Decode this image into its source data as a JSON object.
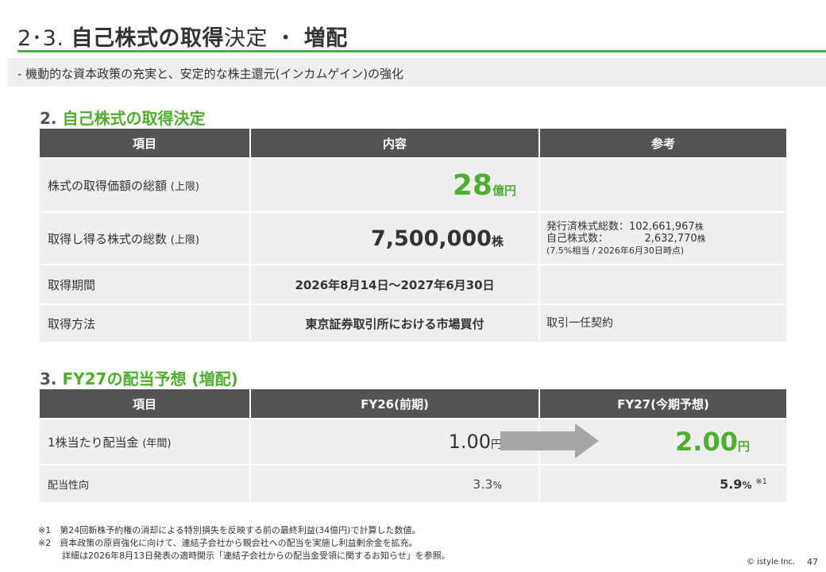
{
  "title": {
    "main_prefix": "2･3. ",
    "bold1": "自己株式の取得",
    "regular": "決定 ・ ",
    "bold2": "増配"
  },
  "subtitle": "- 機動的な資本政策の充実と、安定的な株主還元(インカムゲイン)の強化",
  "section2": {
    "num": "2.",
    "heading": "自己株式の取得決定",
    "headers": [
      "項目",
      "内容",
      "参考"
    ],
    "rows": {
      "amount": {
        "label": "株式の取得価額の総額",
        "label_small": "(上限)",
        "value": "28",
        "unit": "億円",
        "ref": ""
      },
      "shares": {
        "label": "取得し得る株式の総数",
        "label_small": "(上限)",
        "value": "7,500,000",
        "unit": "株",
        "ref_line1_a": "発行済株式総数：102,661,967",
        "ref_line1_b": "株",
        "ref_line2_a": "自己株式数：           2,632,770",
        "ref_line2_b": "株",
        "ref_line3": "(7.5%相当 / 2026年6月30日時点)"
      },
      "period": {
        "label": "取得期間",
        "value": "2026年8月14日～2027年6月30日",
        "ref": ""
      },
      "method": {
        "label": "取得方法",
        "value": "東京証券取引所における市場買付",
        "ref": "取引一任契約"
      }
    }
  },
  "section3": {
    "num": "3.",
    "heading": "FY27の配当予想 (増配)",
    "headers": [
      "項目",
      "FY26(前期)",
      "FY27(今期予想)"
    ],
    "dps": {
      "label": "1株当たり配当金",
      "label_small": "(年間)",
      "fy26_value": "1.00",
      "fy26_unit": "円",
      "fy27_value": "2.00",
      "fy27_unit": "円"
    },
    "payout": {
      "label": "配当性向",
      "fy26_value": "3.3",
      "fy26_unit": "%",
      "fy27_value": "5.9",
      "fy27_unit": "%",
      "fy27_note": "※1"
    }
  },
  "footnotes": {
    "n1_mark": "※1",
    "n1": "第24回新株予約権の消却による特別損失を反映する前の最終利益(34億円)で計算した数値。",
    "n2_mark": "※2",
    "n2_line1": "資本政策の原資強化に向けて、連結子会社から親会社への配当を実施し利益剰余金を拡充。",
    "n2_line2": "詳細は2026年8月13日発表の適時開示「連結子会社からの配当金受領に関するお知らせ」を参照。"
  },
  "copyright": "© istyle Inc.",
  "page_number": "47",
  "colors": {
    "accent_green": "#4fad2f",
    "header_gray": "#545454",
    "cell_gray": "#efefef",
    "arrow_gray": "#a6a6a6"
  },
  "icons": {
    "arrow": "right-arrow-icon"
  }
}
